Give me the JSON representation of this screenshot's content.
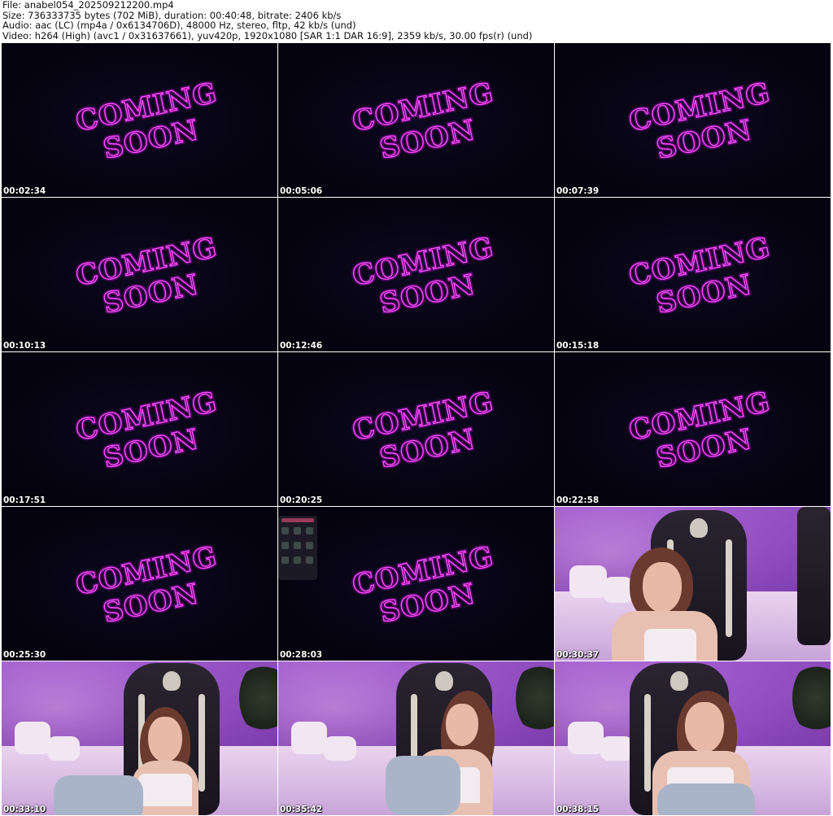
{
  "header": {
    "file": "File: anabel054_202509212200.mp4",
    "size": "Size: 736333735 bytes (702 MiB), duration: 00:40:48, bitrate: 2406 kb/s",
    "audio": "Audio: aac (LC) (mp4a / 0x6134706D), 48000 Hz, stereo, fltp, 42 kb/s (und)",
    "video": "Video: h264 (High) (avc1 / 0x31637661), yuv420p, 1920x1080 [SAR 1:1 DAR 16:9], 2359 kb/s, 30.00 fps(r) (und)"
  },
  "overlay_text": [
    "COMING",
    "SOON"
  ],
  "colors": {
    "neon": "#ff4dff",
    "dark_bg": "#05030f",
    "room": "#a35fcf"
  },
  "thumbnails": [
    {
      "time": "00:02:34",
      "scene": "coming-soon"
    },
    {
      "time": "00:05:06",
      "scene": "coming-soon"
    },
    {
      "time": "00:07:39",
      "scene": "coming-soon"
    },
    {
      "time": "00:10:13",
      "scene": "coming-soon"
    },
    {
      "time": "00:12:46",
      "scene": "coming-soon"
    },
    {
      "time": "00:15:18",
      "scene": "coming-soon"
    },
    {
      "time": "00:17:51",
      "scene": "coming-soon"
    },
    {
      "time": "00:20:25",
      "scene": "coming-soon"
    },
    {
      "time": "00:22:58",
      "scene": "coming-soon"
    },
    {
      "time": "00:25:30",
      "scene": "coming-soon"
    },
    {
      "time": "00:28:03",
      "scene": "coming-soon-with-panel"
    },
    {
      "time": "00:30:37",
      "scene": "room"
    },
    {
      "time": "00:33:10",
      "scene": "room"
    },
    {
      "time": "00:35:42",
      "scene": "room"
    },
    {
      "time": "00:38:15",
      "scene": "room"
    }
  ]
}
